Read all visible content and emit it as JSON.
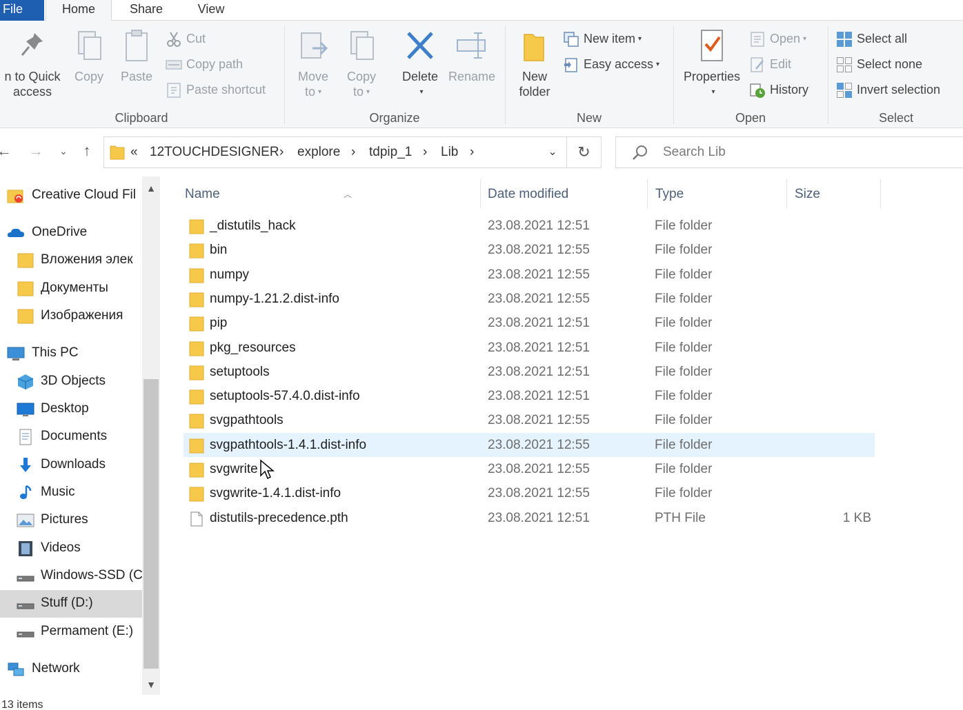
{
  "ribbon_tabs": {
    "file": "File",
    "home": "Home",
    "share": "Share",
    "view": "View"
  },
  "clipboard": {
    "group_label": "Clipboard",
    "pin_label_1": "n to Quick",
    "pin_label_2": "access",
    "copy": "Copy",
    "paste": "Paste",
    "cut": "Cut",
    "copy_path": "Copy path",
    "paste_shortcut": "Paste shortcut"
  },
  "organize": {
    "group_label": "Organize",
    "move_to_1": "Move",
    "move_to_2": "to",
    "copy_to_1": "Copy",
    "copy_to_2": "to",
    "delete": "Delete",
    "rename": "Rename"
  },
  "new": {
    "group_label": "New",
    "new_folder_1": "New",
    "new_folder_2": "folder",
    "new_item": "New item",
    "easy_access": "Easy access"
  },
  "open": {
    "group_label": "Open",
    "properties": "Properties",
    "open": "Open",
    "edit": "Edit",
    "history": "History"
  },
  "select": {
    "group_label": "Select",
    "select_all": "Select all",
    "select_none": "Select none",
    "invert_selection": "Invert selection"
  },
  "address": {
    "overflow": "«",
    "crumbs": [
      "12TOUCHDESIGNER",
      "explore",
      "tdpip_1",
      "Lib"
    ],
    "sep": "›"
  },
  "search": {
    "placeholder": "Search Lib"
  },
  "nav_pane": {
    "items": [
      {
        "label": "Creative Cloud Fil",
        "icon": "creative-cloud-icon"
      },
      {
        "label": "OneDrive",
        "icon": "onedrive-icon"
      },
      {
        "label": "Вложения элек",
        "icon": "folder-icon"
      },
      {
        "label": "Документы",
        "icon": "folder-icon"
      },
      {
        "label": "Изображения",
        "icon": "folder-icon"
      },
      {
        "label": "This PC",
        "icon": "this-pc-icon"
      },
      {
        "label": "3D Objects",
        "icon": "3d-objects-icon"
      },
      {
        "label": "Desktop",
        "icon": "desktop-icon"
      },
      {
        "label": "Documents",
        "icon": "documents-icon"
      },
      {
        "label": "Downloads",
        "icon": "downloads-icon"
      },
      {
        "label": "Music",
        "icon": "music-icon"
      },
      {
        "label": "Pictures",
        "icon": "pictures-icon"
      },
      {
        "label": "Videos",
        "icon": "videos-icon"
      },
      {
        "label": "Windows-SSD (C",
        "icon": "drive-icon"
      },
      {
        "label": "Stuff (D:)",
        "icon": "drive-icon"
      },
      {
        "label": "Permament (E:)",
        "icon": "drive-icon"
      },
      {
        "label": "Network",
        "icon": "network-icon"
      }
    ],
    "selected": "Stuff (D:)"
  },
  "columns": {
    "name": "Name",
    "date": "Date modified",
    "type": "Type",
    "size": "Size"
  },
  "files": [
    {
      "name": "_distutils_hack",
      "date": "23.08.2021 12:51",
      "type": "File folder",
      "size": ""
    },
    {
      "name": "bin",
      "date": "23.08.2021 12:55",
      "type": "File folder",
      "size": ""
    },
    {
      "name": "numpy",
      "date": "23.08.2021 12:55",
      "type": "File folder",
      "size": ""
    },
    {
      "name": "numpy-1.21.2.dist-info",
      "date": "23.08.2021 12:55",
      "type": "File folder",
      "size": ""
    },
    {
      "name": "pip",
      "date": "23.08.2021 12:51",
      "type": "File folder",
      "size": ""
    },
    {
      "name": "pkg_resources",
      "date": "23.08.2021 12:51",
      "type": "File folder",
      "size": ""
    },
    {
      "name": "setuptools",
      "date": "23.08.2021 12:51",
      "type": "File folder",
      "size": ""
    },
    {
      "name": "setuptools-57.4.0.dist-info",
      "date": "23.08.2021 12:51",
      "type": "File folder",
      "size": ""
    },
    {
      "name": "svgpathtools",
      "date": "23.08.2021 12:55",
      "type": "File folder",
      "size": ""
    },
    {
      "name": "svgpathtools-1.4.1.dist-info",
      "date": "23.08.2021 12:55",
      "type": "File folder",
      "size": ""
    },
    {
      "name": "svgwrite",
      "date": "23.08.2021 12:55",
      "type": "File folder",
      "size": ""
    },
    {
      "name": "svgwrite-1.4.1.dist-info",
      "date": "23.08.2021 12:55",
      "type": "File folder",
      "size": ""
    },
    {
      "name": "distutils-precedence.pth",
      "date": "23.08.2021 12:51",
      "type": "PTH File",
      "size": "1 KB"
    }
  ],
  "hovered_file": "svgpathtools-1.4.1.dist-info",
  "status_bar": {
    "item_count": "13 items"
  },
  "colors": {
    "accent": "#1f5fb2",
    "folder": "#f7c94b",
    "hover": "#e5f3ff",
    "selected_nav": "#d9d9d9"
  }
}
